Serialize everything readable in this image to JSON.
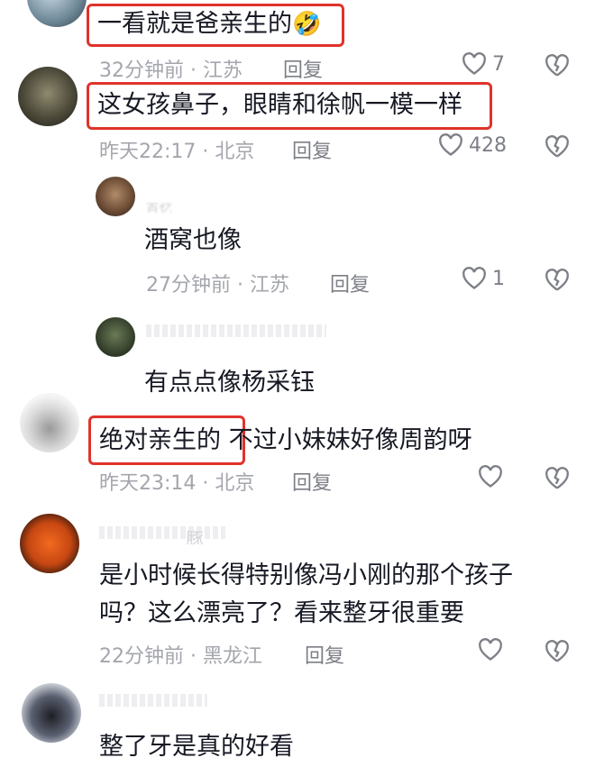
{
  "comments": [
    {
      "text": "一看就是爸亲生的",
      "emoji": "🤣",
      "time": "32分钟前",
      "location": "江苏",
      "reply": "回复",
      "likes": "7"
    },
    {
      "text": "这女孩鼻子，眼睛和徐帆一模一样",
      "time": "昨天22:17",
      "location": "北京",
      "reply": "回复",
      "likes": "428"
    },
    {
      "author": "百忆",
      "text": "酒窝也像",
      "time": "27分钟前",
      "location": "江苏",
      "reply": "回复",
      "likes": "1"
    },
    {
      "text": "有点点像杨采钰"
    },
    {
      "text_part1": "绝对亲生的",
      "text_part2": "不过小妹妹好像周韵呀",
      "time": "昨天23:14",
      "location": "北京",
      "reply": "回复"
    },
    {
      "author_fragment": "豚",
      "text_line1": "是小时候长得特别像冯小刚的那个孩子",
      "text_line2": "吗？这么漂亮了？看来整牙很重要",
      "time": "22分钟前",
      "location": "黑龙江",
      "reply": "回复"
    },
    {
      "text": "整了牙是真的好看"
    }
  ],
  "separator": "·",
  "colors": {
    "highlight": "#e0332b",
    "meta": "#a4a6ad",
    "text": "#161823"
  }
}
